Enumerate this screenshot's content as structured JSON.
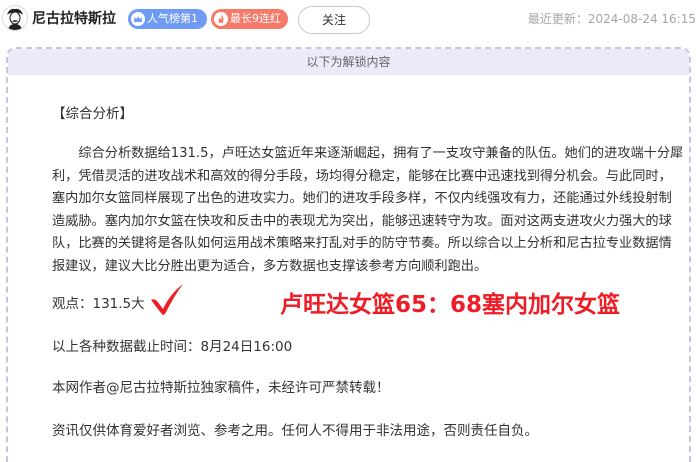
{
  "header": {
    "author_name": "尼古拉特斯拉",
    "badges": [
      {
        "label": "人气榜第1",
        "color": "#6f9bf5",
        "icon": "crown-icon"
      },
      {
        "label": "最长9连红",
        "color": "#f57a6a",
        "icon": "fire-icon"
      }
    ],
    "follow_label": "关注",
    "last_update": "最近更新：2024-08-24 16:15"
  },
  "content": {
    "unlock_notice": "以下为解锁内容",
    "section_title": "【综合分析】",
    "analysis": "综合分析数据给131.5，卢旺达女篮近年来逐渐崛起，拥有了一支攻守兼备的队伍。她们的进攻端十分犀利，凭借灵活的进攻战术和高效的得分手段，场均得分稳定，能够在比赛中迅速找到得分机会。与此同时，塞内加尔女篮同样展现了出色的进攻实力。她们的进攻手段多样，不仅内线强攻有力，还能通过外线投射制造威胁。塞内加尔女篮在快攻和反击中的表现尤为突出，能够迅速转守为攻。面对这两支进攻火力强大的球队，比赛的关键将是各队如何运用战术策略来打乱对手的防守节奏。所以综合以上分析和尼古拉专业数据情报建议，建议大比分胜出更为适合，多方数据也支撑该参考方向顺利跑出。",
    "prediction_label": "观点：131.5大",
    "result_icon": "red-check-icon",
    "final_score": "卢旺达女篮65：68塞内加尔女篮",
    "cutoff_note": "以上各种数据截止时间：8月24日16:00",
    "copyright": "本网作者@尼古拉特斯拉独家稿件，未经许可严禁转载！",
    "disclaimer": "资讯仅供体育爱好者浏览、参考之用。任何人不得用于非法用途，否则责任自负。"
  },
  "colors": {
    "accent_red": "#ee1c25",
    "card_border": "#c8c3e8",
    "unlock_bar_bg": "#ece9f8"
  }
}
